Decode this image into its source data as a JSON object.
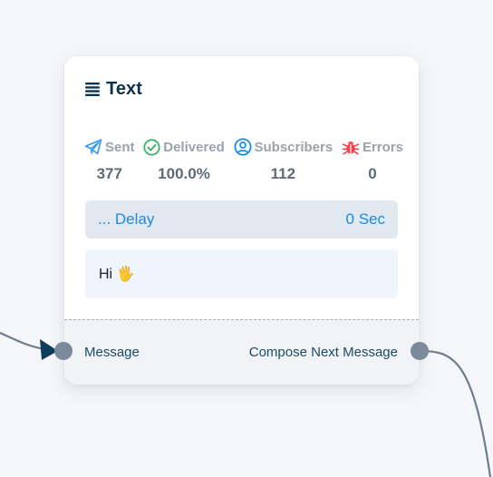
{
  "node": {
    "title": "Text",
    "title_icon": "list-lines-icon",
    "stats": [
      {
        "icon": "paper-plane-icon",
        "label": "Sent",
        "value": "377",
        "icon_color": "#3aa0e8"
      },
      {
        "icon": "check-circle-icon",
        "label": "Delivered",
        "value": "100.0%",
        "icon_color": "#39b36b"
      },
      {
        "icon": "user-circle-icon",
        "label": "Subscribers",
        "value": "112",
        "icon_color": "#1a8be0"
      },
      {
        "icon": "bug-icon",
        "label": "Errors",
        "value": "0",
        "icon_color": "#f0424a"
      }
    ],
    "delay": {
      "label": "... Delay",
      "value": "0 Sec"
    },
    "message": {
      "text": "Hi 🖐️"
    },
    "footer": {
      "input_label": "Message",
      "output_label": "Compose Next Message"
    }
  },
  "colors": {
    "accent": "#1a8be0",
    "title": "#0e3350",
    "port": "#7c8a9b",
    "edge": "#6f7d8e",
    "arrow": "#0e3d5c"
  }
}
